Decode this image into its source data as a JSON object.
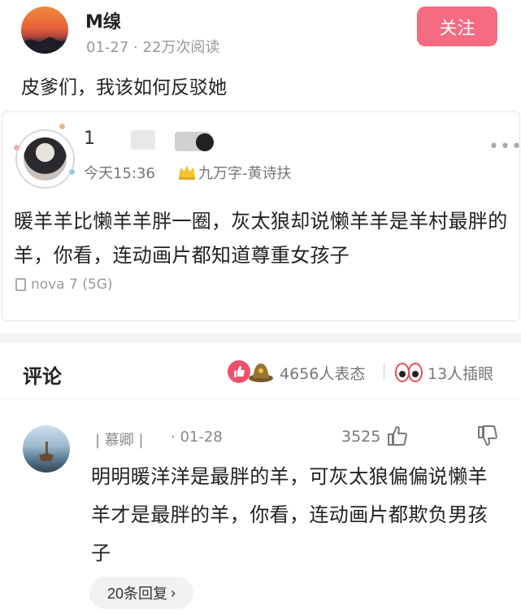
{
  "post": {
    "username": "M缐",
    "date": "01-27",
    "reads": "22万次阅读",
    "follow_label": "关注",
    "text": "皮爹们，我该如何反驳她"
  },
  "card": {
    "name_visible": "1",
    "time": "今天15:36",
    "badge": "九万字-黄诗扶",
    "more": "•••",
    "text": "暖羊羊比懒羊羊胖一圈，灰太狼却说懒羊羊是羊村最胖的羊，你看，连动画片都知道尊重女孩子",
    "device": "nova 7 (5G)"
  },
  "comments_header": {
    "title": "评论",
    "reaction_count": "4656人表态",
    "insert_count": "13人插眼"
  },
  "comment": {
    "user": "| 慕卿 |",
    "date": "· 01-28",
    "likes": "3525",
    "text": "明明暖洋洋是最胖的羊，可灰太狼偏偏说懒羊羊才是最胖的羊，你看，连动画片都欺负男孩子",
    "replies_label": "20条回复"
  },
  "colors": {
    "accent": "#f56b80",
    "like_badge": "#f04f6a"
  }
}
